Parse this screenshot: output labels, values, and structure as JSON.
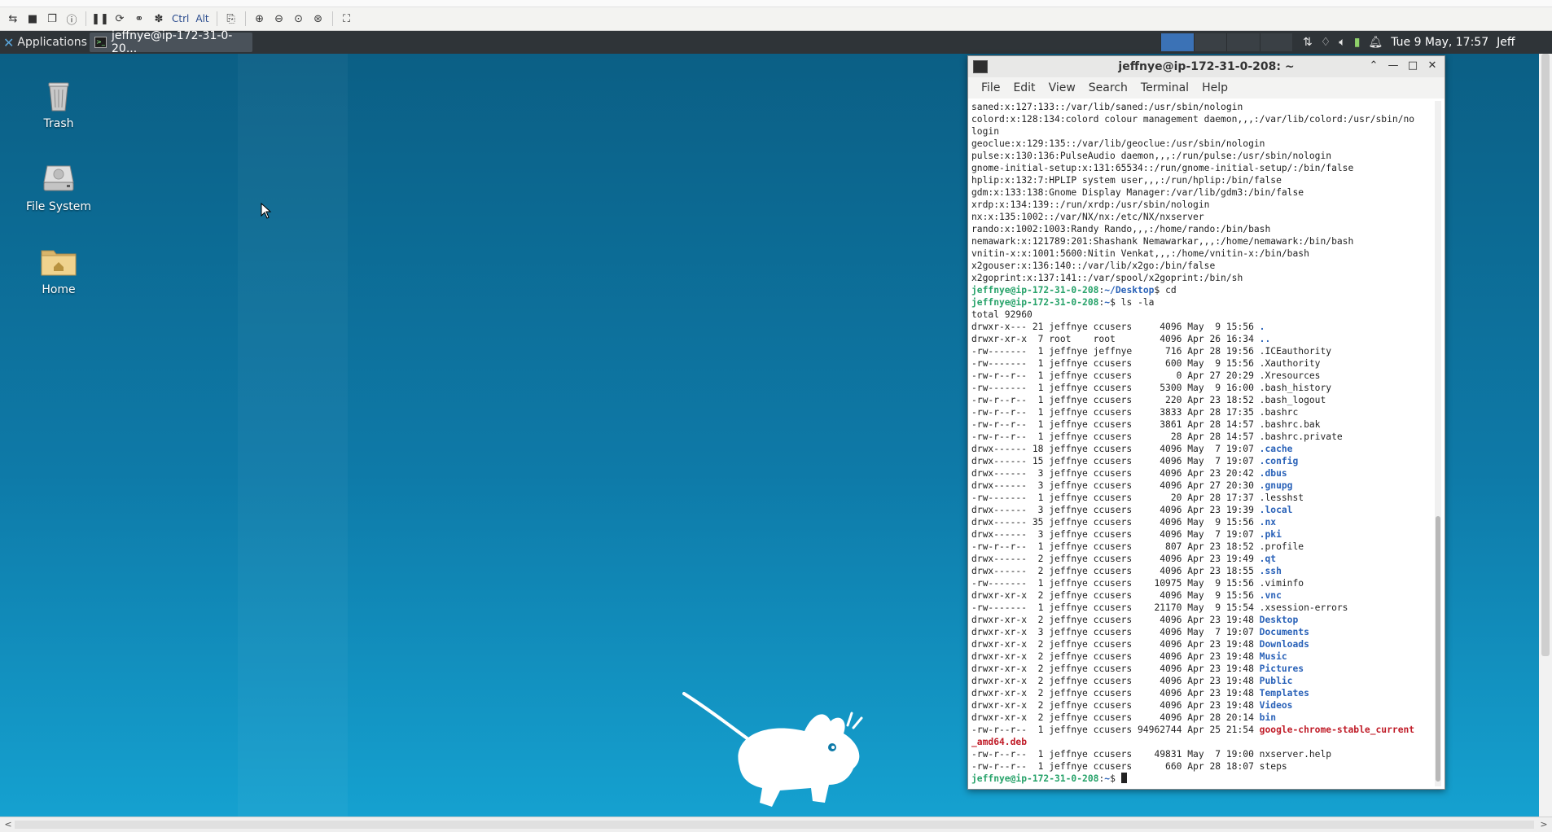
{
  "toolbar": {
    "buttons": [
      {
        "name": "reconnect-icon",
        "glyph": "⇆"
      },
      {
        "name": "save-icon",
        "glyph": "■"
      },
      {
        "name": "copy-icon",
        "glyph": "❐"
      },
      {
        "name": "info-icon",
        "glyph": "ⓘ"
      },
      {
        "name": "pause-icon",
        "glyph": "❚❚"
      },
      {
        "name": "refresh-icon",
        "glyph": "⟳"
      },
      {
        "name": "link-icon",
        "glyph": "⚭"
      },
      {
        "name": "gear-icon",
        "glyph": "✽"
      }
    ],
    "ctrl_label": "Ctrl",
    "alt_label": "Alt",
    "zoom_buttons": [
      {
        "name": "clipboard-icon",
        "glyph": "⎘"
      },
      {
        "name": "zoom-in-icon",
        "glyph": "⊕"
      },
      {
        "name": "zoom-out-icon",
        "glyph": "⊖"
      },
      {
        "name": "zoom-reset-icon",
        "glyph": "⊙"
      },
      {
        "name": "zoom-fit-icon",
        "glyph": "⊛"
      },
      {
        "name": "fullscreen-icon",
        "glyph": "⛶"
      }
    ]
  },
  "panel": {
    "applications_label": "Applications",
    "task_label": "jeffnye@ip-172-31-0-20...",
    "clock": "Tue  9 May, 17:57",
    "user": "Jeff",
    "tray_icons": [
      "network-icon",
      "wifi-icon",
      "volume-icon",
      "battery-icon",
      "notification-icon"
    ]
  },
  "desktop": {
    "icons": [
      {
        "label": "Trash",
        "icon": "trash-icon"
      },
      {
        "label": "File System",
        "icon": "drive-icon"
      },
      {
        "label": "Home",
        "icon": "home-folder-icon"
      }
    ]
  },
  "terminal": {
    "title": "jeffnye@ip-172-31-0-208: ~",
    "menu": [
      "File",
      "Edit",
      "View",
      "Search",
      "Terminal",
      "Help"
    ],
    "lines": [
      [
        {
          "t": "saned:x:127:133::/var/lib/saned:/usr/sbin/nologin"
        }
      ],
      [
        {
          "t": "colord:x:128:134:colord colour management daemon,,,:/var/lib/colord:/usr/sbin/no"
        }
      ],
      [
        {
          "t": "login"
        }
      ],
      [
        {
          "t": "geoclue:x:129:135::/var/lib/geoclue:/usr/sbin/nologin"
        }
      ],
      [
        {
          "t": "pulse:x:130:136:PulseAudio daemon,,,:/run/pulse:/usr/sbin/nologin"
        }
      ],
      [
        {
          "t": "gnome-initial-setup:x:131:65534::/run/gnome-initial-setup/:/bin/false"
        }
      ],
      [
        {
          "t": "hplip:x:132:7:HPLIP system user,,,:/run/hplip:/bin/false"
        }
      ],
      [
        {
          "t": "gdm:x:133:138:Gnome Display Manager:/var/lib/gdm3:/bin/false"
        }
      ],
      [
        {
          "t": "xrdp:x:134:139::/run/xrdp:/usr/sbin/nologin"
        }
      ],
      [
        {
          "t": "nx:x:135:1002::/var/NX/nx:/etc/NX/nxserver"
        }
      ],
      [
        {
          "t": "rando:x:1002:1003:Randy Rando,,,:/home/rando:/bin/bash"
        }
      ],
      [
        {
          "t": "nemawark:x:121789:201:Shashank Nemawarkar,,,:/home/nemawark:/bin/bash"
        }
      ],
      [
        {
          "t": "vnitin-x:x:1001:5600:Nitin Venkat,,,:/home/vnitin-x:/bin/bash"
        }
      ],
      [
        {
          "t": "x2gouser:x:136:140::/var/lib/x2go:/bin/false"
        }
      ],
      [
        {
          "t": "x2goprint:x:137:141::/var/spool/x2goprint:/bin/sh"
        }
      ],
      [
        {
          "t": "jeffnye@ip-172-31-0-208",
          "c": "prompt"
        },
        {
          "t": ":"
        },
        {
          "t": "~/Desktop",
          "c": "path"
        },
        {
          "t": "$ cd"
        }
      ],
      [
        {
          "t": "jeffnye@ip-172-31-0-208",
          "c": "prompt"
        },
        {
          "t": ":"
        },
        {
          "t": "~",
          "c": "path"
        },
        {
          "t": "$ ls -la"
        }
      ],
      [
        {
          "t": "total 92960"
        }
      ],
      [
        {
          "t": "drwxr-x--- 21 jeffnye ccusers     4096 May  9 15:56 "
        },
        {
          "t": ".",
          "c": "dir"
        }
      ],
      [
        {
          "t": "drwxr-xr-x  7 root    root        4096 Apr 26 16:34 "
        },
        {
          "t": "..",
          "c": "dir"
        }
      ],
      [
        {
          "t": "-rw-------  1 jeffnye jeffnye      716 Apr 28 19:56 .ICEauthority"
        }
      ],
      [
        {
          "t": "-rw-------  1 jeffnye ccusers      600 May  9 15:56 .Xauthority"
        }
      ],
      [
        {
          "t": "-rw-r--r--  1 jeffnye ccusers        0 Apr 27 20:29 .Xresources"
        }
      ],
      [
        {
          "t": "-rw-------  1 jeffnye ccusers     5300 May  9 16:00 .bash_history"
        }
      ],
      [
        {
          "t": "-rw-r--r--  1 jeffnye ccusers      220 Apr 23 18:52 .bash_logout"
        }
      ],
      [
        {
          "t": "-rw-r--r--  1 jeffnye ccusers     3833 Apr 28 17:35 .bashrc"
        }
      ],
      [
        {
          "t": "-rw-r--r--  1 jeffnye ccusers     3861 Apr 28 14:57 .bashrc.bak"
        }
      ],
      [
        {
          "t": "-rw-r--r--  1 jeffnye ccusers       28 Apr 28 14:57 .bashrc.private"
        }
      ],
      [
        {
          "t": "drwx------ 18 jeffnye ccusers     4096 May  7 19:07 "
        },
        {
          "t": ".cache",
          "c": "dir"
        }
      ],
      [
        {
          "t": "drwx------ 15 jeffnye ccusers     4096 May  7 19:07 "
        },
        {
          "t": ".config",
          "c": "dir"
        }
      ],
      [
        {
          "t": "drwx------  3 jeffnye ccusers     4096 Apr 23 20:42 "
        },
        {
          "t": ".dbus",
          "c": "dir"
        }
      ],
      [
        {
          "t": "drwx------  3 jeffnye ccusers     4096 Apr 27 20:30 "
        },
        {
          "t": ".gnupg",
          "c": "dir"
        }
      ],
      [
        {
          "t": "-rw-------  1 jeffnye ccusers       20 Apr 28 17:37 .lesshst"
        }
      ],
      [
        {
          "t": "drwx------  3 jeffnye ccusers     4096 Apr 23 19:39 "
        },
        {
          "t": ".local",
          "c": "dir"
        }
      ],
      [
        {
          "t": "drwx------ 35 jeffnye ccusers     4096 May  9 15:56 "
        },
        {
          "t": ".nx",
          "c": "dir"
        }
      ],
      [
        {
          "t": "drwx------  3 jeffnye ccusers     4096 May  7 19:07 "
        },
        {
          "t": ".pki",
          "c": "dir"
        }
      ],
      [
        {
          "t": "-rw-r--r--  1 jeffnye ccusers      807 Apr 23 18:52 .profile"
        }
      ],
      [
        {
          "t": "drwx------  2 jeffnye ccusers     4096 Apr 23 19:49 "
        },
        {
          "t": ".qt",
          "c": "dir"
        }
      ],
      [
        {
          "t": "drwx------  2 jeffnye ccusers     4096 Apr 23 18:55 "
        },
        {
          "t": ".ssh",
          "c": "dir"
        }
      ],
      [
        {
          "t": "-rw-------  1 jeffnye ccusers    10975 May  9 15:56 .viminfo"
        }
      ],
      [
        {
          "t": "drwxr-xr-x  2 jeffnye ccusers     4096 May  9 15:56 "
        },
        {
          "t": ".vnc",
          "c": "dir"
        }
      ],
      [
        {
          "t": "-rw-------  1 jeffnye ccusers    21170 May  9 15:54 .xsession-errors"
        }
      ],
      [
        {
          "t": "drwxr-xr-x  2 jeffnye ccusers     4096 Apr 23 19:48 "
        },
        {
          "t": "Desktop",
          "c": "dir"
        }
      ],
      [
        {
          "t": "drwxr-xr-x  3 jeffnye ccusers     4096 May  7 19:07 "
        },
        {
          "t": "Documents",
          "c": "dir"
        }
      ],
      [
        {
          "t": "drwxr-xr-x  2 jeffnye ccusers     4096 Apr 23 19:48 "
        },
        {
          "t": "Downloads",
          "c": "dir"
        }
      ],
      [
        {
          "t": "drwxr-xr-x  2 jeffnye ccusers     4096 Apr 23 19:48 "
        },
        {
          "t": "Music",
          "c": "dir"
        }
      ],
      [
        {
          "t": "drwxr-xr-x  2 jeffnye ccusers     4096 Apr 23 19:48 "
        },
        {
          "t": "Pictures",
          "c": "dir"
        }
      ],
      [
        {
          "t": "drwxr-xr-x  2 jeffnye ccusers     4096 Apr 23 19:48 "
        },
        {
          "t": "Public",
          "c": "dir"
        }
      ],
      [
        {
          "t": "drwxr-xr-x  2 jeffnye ccusers     4096 Apr 23 19:48 "
        },
        {
          "t": "Templates",
          "c": "dir"
        }
      ],
      [
        {
          "t": "drwxr-xr-x  2 jeffnye ccusers     4096 Apr 23 19:48 "
        },
        {
          "t": "Videos",
          "c": "dir"
        }
      ],
      [
        {
          "t": "drwxr-xr-x  2 jeffnye ccusers     4096 Apr 28 20:14 "
        },
        {
          "t": "bin",
          "c": "dir"
        }
      ],
      [
        {
          "t": "-rw-r--r--  1 jeffnye ccusers 94962744 Apr 25 21:54 "
        },
        {
          "t": "google-chrome-stable_current",
          "c": "deb"
        }
      ],
      [
        {
          "t": "_amd64.deb",
          "c": "deb"
        }
      ],
      [
        {
          "t": "-rw-r--r--  1 jeffnye ccusers    49831 May  7 19:00 nxserver.help"
        }
      ],
      [
        {
          "t": "-rw-r--r--  1 jeffnye ccusers      660 Apr 28 18:07 steps"
        }
      ],
      [
        {
          "t": "jeffnye@ip-172-31-0-208",
          "c": "prompt"
        },
        {
          "t": ":"
        },
        {
          "t": "~",
          "c": "path"
        },
        {
          "t": "$ "
        }
      ]
    ]
  },
  "colors": {
    "panel_bg": "#2f3438",
    "desktop_top": "#0b5f85",
    "desktop_bottom": "#15a1d0",
    "prompt": "#26a269",
    "dir": "#2a62b8",
    "deb": "#c01c28"
  }
}
